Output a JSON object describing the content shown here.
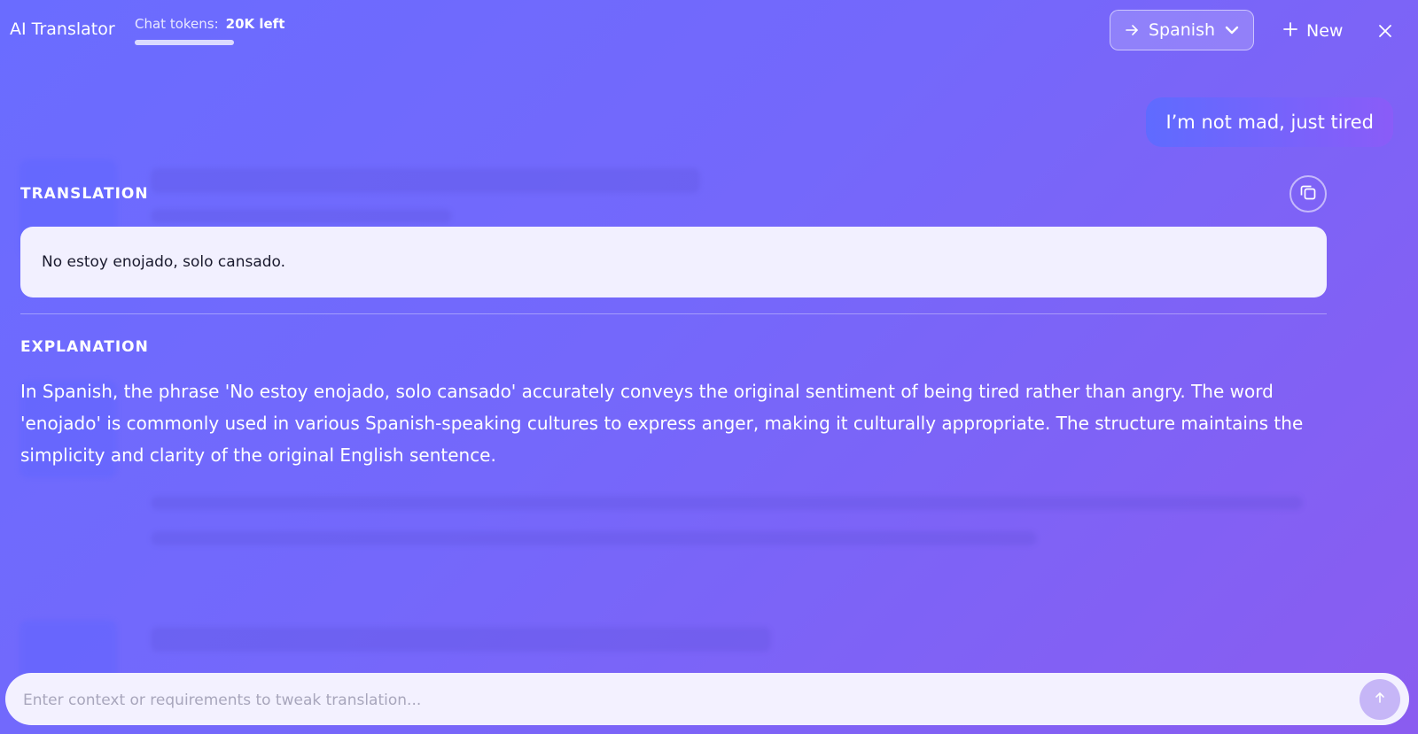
{
  "header": {
    "app_title": "AI Translator",
    "tokens_label": "Chat tokens:",
    "tokens_value": "20K left",
    "tokens_fill_fraction": 1.0,
    "language_select": {
      "selected": "Spanish",
      "icon": "arrow-right-icon"
    },
    "new_label": "New",
    "close_icon": "close-icon"
  },
  "conversation": {
    "user_message": "I’m not mad, just tired"
  },
  "translation": {
    "heading": "TRANSLATION",
    "text": "No estoy enojado, solo cansado.",
    "copy_icon": "copy-icon"
  },
  "explanation": {
    "heading": "EXPLANATION",
    "text": "In Spanish, the phrase 'No estoy enojado, solo cansado' accurately conveys the original sentiment of being tired rather than angry. The word 'enojado' is commonly used in various Spanish-speaking cultures to express anger, making it culturally appropriate. The structure maintains the simplicity and clarity of the original English sentence."
  },
  "input": {
    "placeholder": "Enter context or requirements to tweak translation...",
    "value": "",
    "send_icon": "arrow-up-icon"
  },
  "colors": {
    "background_start": "#6a6cff",
    "background_end": "#8a5cf0",
    "translation_box": "#f2f0ff",
    "send_button": "#c6b6f7"
  }
}
